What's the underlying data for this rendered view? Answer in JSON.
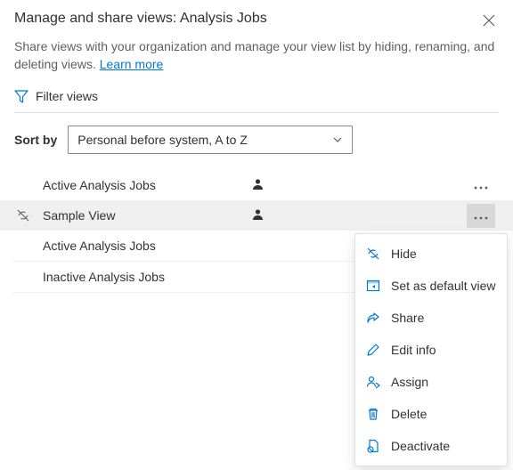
{
  "header": {
    "title": "Manage and share views: Analysis Jobs",
    "close_label": "Close"
  },
  "description": {
    "text": "Share views with your organization and manage your view list by hiding, renaming, and deleting views. ",
    "link": "Learn more"
  },
  "filter": {
    "label": "Filter views"
  },
  "sort": {
    "label": "Sort by",
    "selected": "Personal before system, A to Z"
  },
  "views": [
    {
      "label": "Active Analysis Jobs",
      "personal": true,
      "hidden": false,
      "selected": false
    },
    {
      "label": "Sample View",
      "personal": true,
      "hidden": true,
      "selected": true
    },
    {
      "label": "Active Analysis Jobs",
      "personal": false,
      "hidden": false,
      "selected": false
    },
    {
      "label": "Inactive Analysis Jobs",
      "personal": false,
      "hidden": false,
      "selected": false
    }
  ],
  "context_menu": {
    "items": [
      {
        "icon": "hide-icon",
        "label": "Hide"
      },
      {
        "icon": "default-view-icon",
        "label": "Set as default view"
      },
      {
        "icon": "share-icon",
        "label": "Share"
      },
      {
        "icon": "edit-icon",
        "label": "Edit info"
      },
      {
        "icon": "assign-icon",
        "label": "Assign"
      },
      {
        "icon": "delete-icon",
        "label": "Delete"
      },
      {
        "icon": "deactivate-icon",
        "label": "Deactivate"
      }
    ]
  }
}
